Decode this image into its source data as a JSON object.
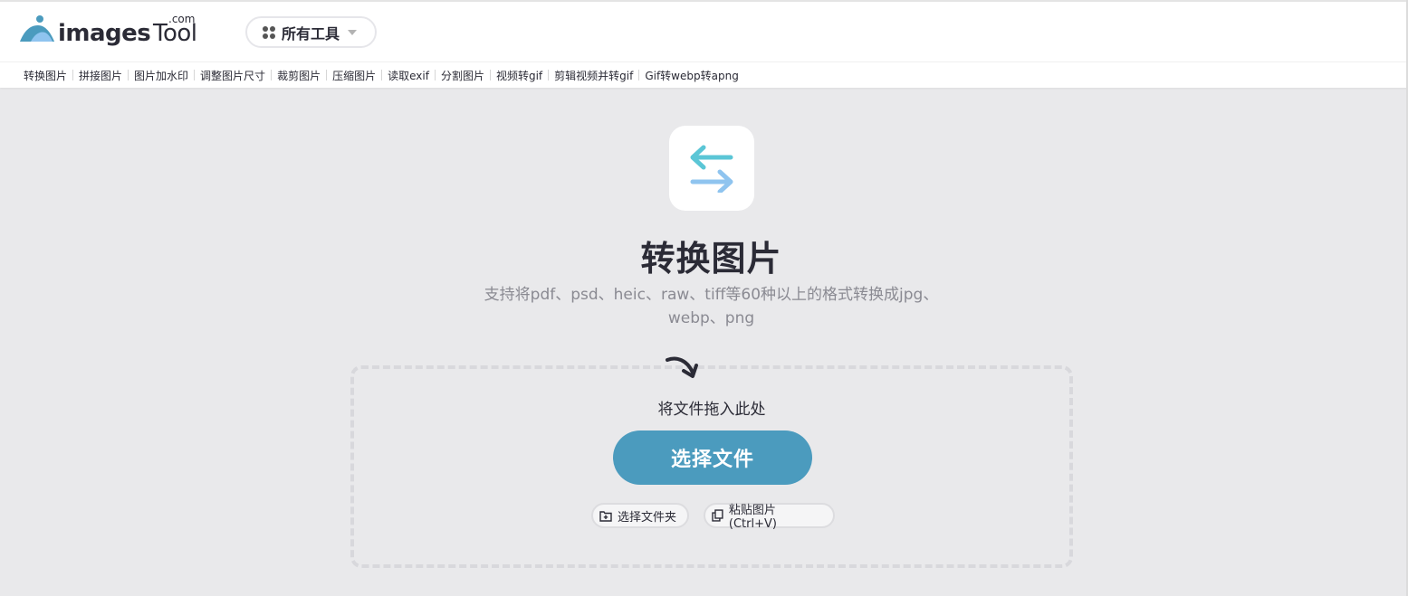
{
  "header": {
    "logo": {
      "images_text": "images",
      "tool_text": "Tool",
      "com_text": ".com"
    },
    "tools_button_label": "所有工具"
  },
  "nav": {
    "items": [
      {
        "label": "转换图片"
      },
      {
        "label": "拼接图片"
      },
      {
        "label": "图片加水印"
      },
      {
        "label": "调整图片尺寸"
      },
      {
        "label": "裁剪图片"
      },
      {
        "label": "压缩图片"
      },
      {
        "label": "读取exif"
      },
      {
        "label": "分割图片"
      },
      {
        "label": "视频转gif"
      },
      {
        "label": "剪辑视频并转gif"
      },
      {
        "label": "Gif转webp转apng"
      }
    ]
  },
  "main": {
    "tool_icon": "swap-arrows-icon",
    "title": "转换图片",
    "subtitle": "支持将pdf、psd、heic、raw、tiff等60种以上的格式转换成jpg、webp、png",
    "dropzone": {
      "drop_text": "将文件拖入此处",
      "choose_button": "选择文件",
      "folder_button": "选择文件夹",
      "paste_button": "粘贴图片 (Ctrl+V)"
    }
  },
  "colors": {
    "background": "#e9e9eb",
    "primary_button": "#4b9bbe",
    "icon_teal": "#5bc6d6",
    "icon_light_blue": "#8fc4ef",
    "text_dark": "#2b2b36",
    "text_muted": "#8a8a92"
  }
}
